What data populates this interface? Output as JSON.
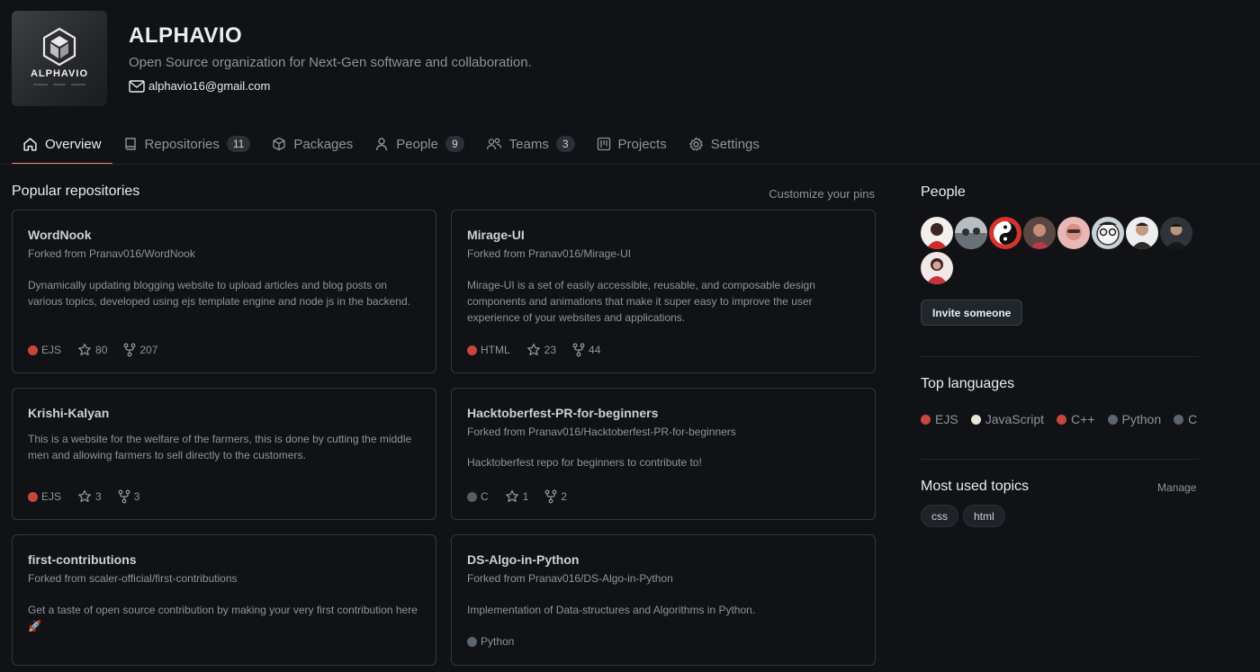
{
  "org": {
    "logo_text": "ALPHAVIO",
    "name": "ALPHAVIO",
    "description": "Open Source organization for Next-Gen software and collaboration.",
    "email": "alphavio16@gmail.com"
  },
  "nav": {
    "tabs": [
      {
        "label": "Overview",
        "icon": "home-icon",
        "active": true
      },
      {
        "label": "Repositories",
        "icon": "repo-icon",
        "count": "11"
      },
      {
        "label": "Packages",
        "icon": "package-icon"
      },
      {
        "label": "People",
        "icon": "person-icon",
        "count": "9"
      },
      {
        "label": "Teams",
        "icon": "people-icon",
        "count": "3"
      },
      {
        "label": "Projects",
        "icon": "project-icon"
      },
      {
        "label": "Settings",
        "icon": "gear-icon"
      }
    ]
  },
  "popular": {
    "title": "Popular repositories",
    "customize_label": "Customize your pins",
    "repos": [
      {
        "name": "WordNook",
        "forked_from": "Forked from Pranav016/WordNook",
        "description": "Dynamically updating blogging website to upload articles and blog posts on various topics, developed using ejs template engine and node js in the backend.",
        "language": "EJS",
        "language_color": "#d9534f",
        "stars": "80",
        "forks": "207"
      },
      {
        "name": "Mirage-UI",
        "forked_from": "Forked from Pranav016/Mirage-UI",
        "description": "Mirage-UI is a set of easily accessible, reusable, and composable design components and animations that make it super easy to improve the user experience of your websites and applications.",
        "language": "HTML",
        "language_color": "#e34c26",
        "stars": "23",
        "forks": "44"
      },
      {
        "name": "Krishi-Kalyan",
        "forked_from": "",
        "description": "This is a website for the welfare of the farmers, this is done by cutting the middle men and allowing farmers to sell directly to the customers.",
        "language": "EJS",
        "language_color": "#d9534f",
        "stars": "3",
        "forks": "3"
      },
      {
        "name": "Hacktoberfest-PR-for-beginners",
        "forked_from": "Forked from Pranav016/Hacktoberfest-PR-for-beginners",
        "description": "Hacktoberfest repo for beginners to contribute to!",
        "language": "C",
        "language_color": "#555d66",
        "stars": "1",
        "forks": "2"
      },
      {
        "name": "first-contributions",
        "forked_from": "Forked from scaler-official/first-contributions",
        "description": "Get a taste of open source contribution by making your very first contribution here 🚀",
        "language": "",
        "language_color": "",
        "stars": "",
        "forks": ""
      },
      {
        "name": "DS-Algo-in-Python",
        "forked_from": "Forked from Pranav016/DS-Algo-in-Python",
        "description": "Implementation of Data-structures and Algorithms in Python.",
        "language": "Python",
        "language_color": "#3572A5",
        "stars": "",
        "forks": ""
      }
    ]
  },
  "sidebar": {
    "people_title": "People",
    "invite_label": "Invite someone",
    "languages_title": "Top languages",
    "languages": [
      {
        "name": "EJS",
        "color": "#c9463d"
      },
      {
        "name": "JavaScript",
        "color": "#e8e6d9"
      },
      {
        "name": "C++",
        "color": "#c9463d"
      },
      {
        "name": "Python",
        "color": "#5b6570"
      },
      {
        "name": "C",
        "color": "#5b6570"
      }
    ],
    "topics_title": "Most used topics",
    "manage_label": "Manage",
    "topics": [
      "css",
      "html"
    ]
  }
}
